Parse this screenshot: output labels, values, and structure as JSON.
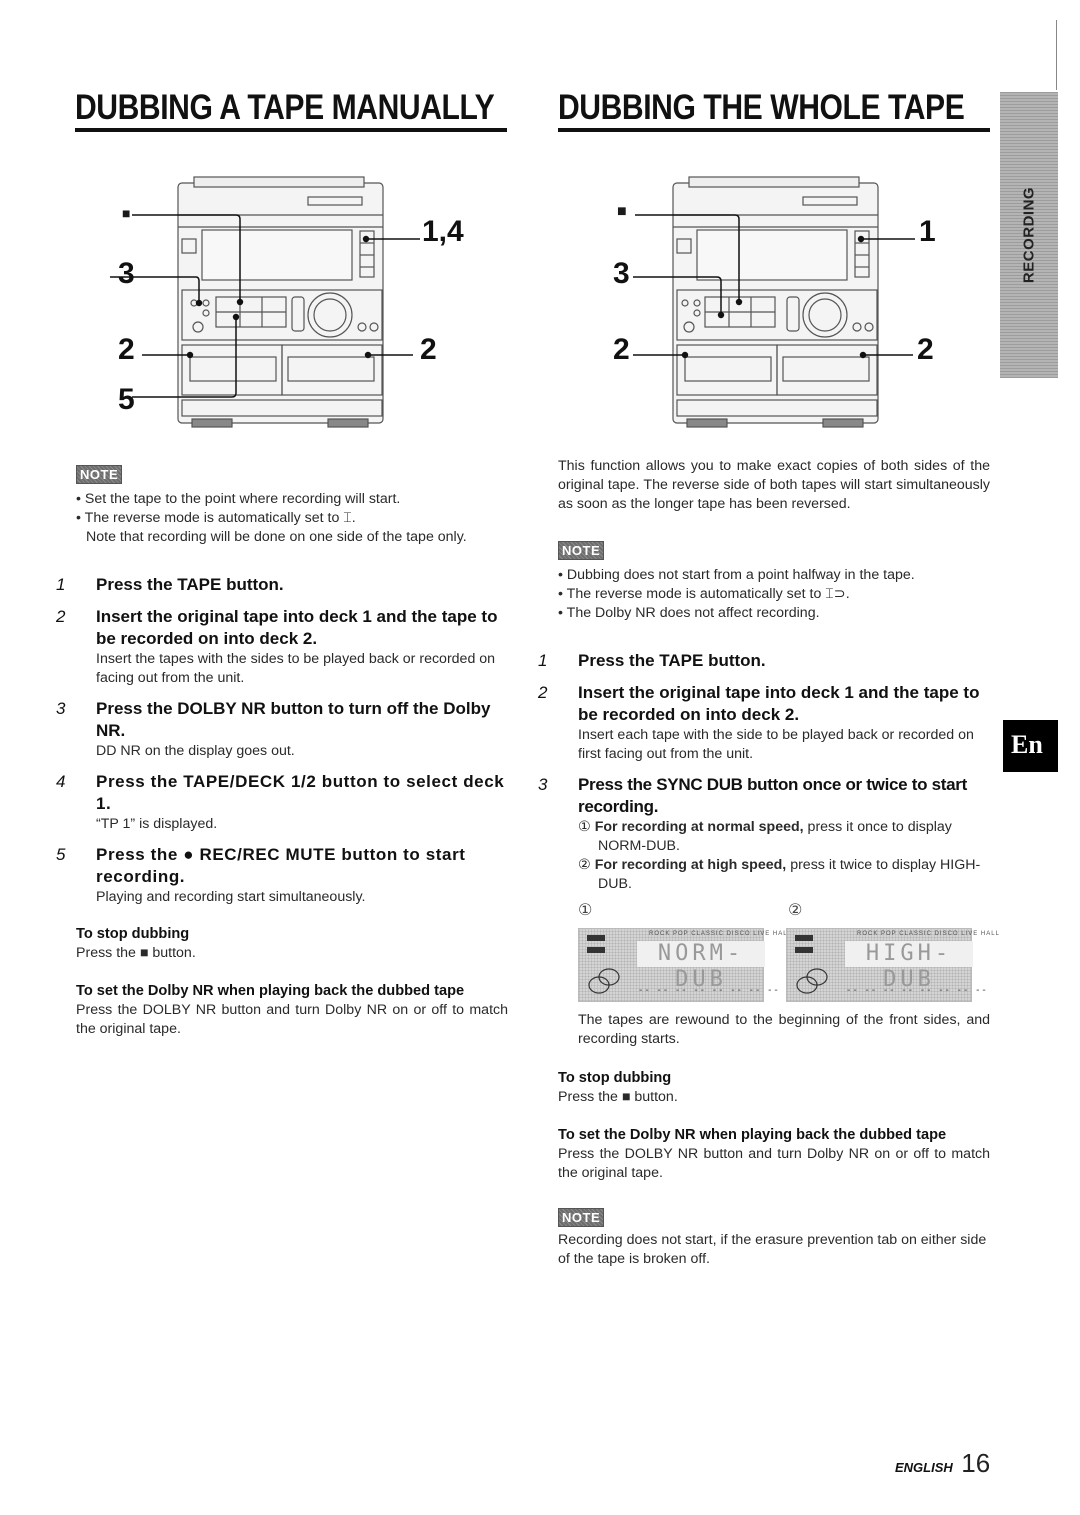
{
  "left": {
    "title": "DUBBING A TAPE MANUALLY",
    "diagram": {
      "callouts": {
        "stop": "■",
        "c14": "1,4",
        "c3": "3",
        "c2l": "2",
        "c2r": "2",
        "c5": "5"
      }
    },
    "note": {
      "badge": "NOTE",
      "bullets": [
        "• Set the tape to the point where recording will start.",
        "• The reverse mode is automatically set to ⌶."
      ],
      "extra": "Note that recording will be done on one side of the tape only."
    },
    "steps": [
      {
        "num": "1",
        "text": "Press the TAPE button.",
        "detail": ""
      },
      {
        "num": "2",
        "text": "Insert the original tape into deck 1 and the tape to be recorded on into deck 2.",
        "detail": "Insert the tapes with the sides to be played back or recorded on facing out from the unit."
      },
      {
        "num": "3",
        "text": "Press the DOLBY NR button to turn off the Dolby NR.",
        "detail": "DD NR on the display goes out."
      },
      {
        "num": "4",
        "text": "Press the TAPE/DECK 1/2 button to select deck 1.",
        "detail": "“TP 1” is displayed."
      },
      {
        "num": "5",
        "text": "Press the ● REC/REC MUTE button to start recording.",
        "detail": "Playing and recording start simultaneously."
      }
    ],
    "stop": {
      "heading": "To stop dubbing",
      "text": "Press the ■ button."
    },
    "dolby": {
      "heading": "To set the Dolby NR when playing back the dubbed tape",
      "text": "Press the DOLBY NR button and turn Dolby NR on or off to match the original tape."
    }
  },
  "right": {
    "title": "DUBBING THE WHOLE TAPE",
    "diagram": {
      "callouts": {
        "stop": "■",
        "c1": "1",
        "c3": "3",
        "c2l": "2",
        "c2r": "2"
      }
    },
    "intro": "This function allows you to make exact copies of both sides of the original tape. The reverse side of both tapes will start simultaneously as soon as the longer tape has been reversed.",
    "note": {
      "badge": "NOTE",
      "bullets": [
        "• Dubbing does not start from a point halfway in the tape.",
        "• The reverse mode is automatically set to ⌶⊃.",
        "• The Dolby NR does not affect recording."
      ]
    },
    "steps": [
      {
        "num": "1",
        "text": "Press the TAPE button.",
        "detail": ""
      },
      {
        "num": "2",
        "text": "Insert the original tape into deck 1 and the tape to be recorded on into deck 2.",
        "detail": "Insert each tape with the side to be played back or recorded on first facing out from the unit."
      },
      {
        "num": "3",
        "text": "Press the SYNC DUB button once or twice to start recording.",
        "detail": ""
      }
    ],
    "options": [
      {
        "marker": "①",
        "bold": "For recording at normal speed,",
        "text": " press it once to display NORM-DUB."
      },
      {
        "marker": "②",
        "bold": "For recording at high speed,",
        "text": " press it twice to display HIGH-DUB."
      }
    ],
    "displays": [
      {
        "marker": "①",
        "text": "NORM-DUB",
        "modes": "ROCK POP CLASSIC DISCO LIVE HALL",
        "dashes": "-- -- -- -- -- -- -- --"
      },
      {
        "marker": "②",
        "text": "HIGH-DUB",
        "modes": "ROCK POP CLASSIC DISCO LIVE HALL",
        "dashes": "-- -- -- -- -- -- -- --"
      }
    ],
    "after": "The tapes are rewound to the beginning of the front sides, and recording starts.",
    "stop": {
      "heading": "To stop dubbing",
      "text": "Press the ■ button."
    },
    "dolby": {
      "heading": "To set the Dolby NR when playing back the dubbed tape",
      "text": "Press the DOLBY NR button and turn Dolby NR on or off to match the original tape."
    },
    "note2": {
      "badge": "NOTE",
      "text": "Recording does not start, if the erasure prevention tab on either side of the tape is broken off."
    }
  },
  "side_tab": {
    "label": "RECORDING"
  },
  "lang_tab": {
    "label": "En"
  },
  "footer": {
    "language": "ENGLISH",
    "page": "16"
  }
}
